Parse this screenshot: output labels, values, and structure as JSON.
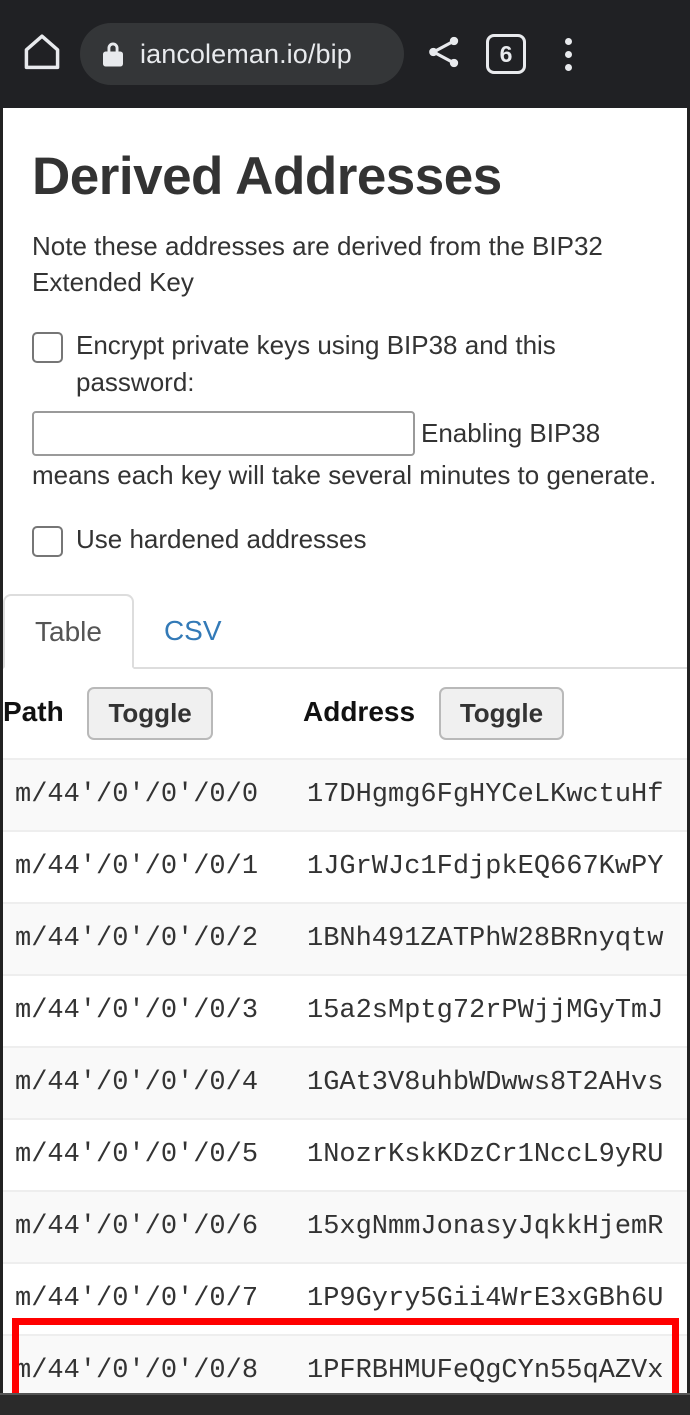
{
  "browser": {
    "home_icon": "home-icon",
    "lock_icon": "lock-icon",
    "url": "iancoleman.io/bip",
    "share_icon": "share-icon",
    "tab_count": "6",
    "menu_icon": "overflow-menu-icon"
  },
  "content": {
    "title": "Derived Addresses",
    "note": "Note these addresses are derived from the BIP32 Extended Key",
    "bip38": {
      "checkbox_label": "Encrypt private keys using BIP38 and this password:",
      "password_value": "",
      "password_placeholder": "",
      "after_input_text": "Enabling BIP38",
      "tail_text": "means each key will take several minutes to generate."
    },
    "hardened": {
      "checkbox_label": "Use hardened addresses"
    },
    "tabs": [
      {
        "label": "Table",
        "active": true
      },
      {
        "label": "CSV",
        "active": false
      }
    ],
    "table": {
      "headers": {
        "path": "Path",
        "path_toggle": "Toggle",
        "address": "Address",
        "address_toggle": "Toggle"
      },
      "rows": [
        {
          "path": "m/44'/0'/0'/0/0",
          "address": "17DHgmg6FgHYCeLKwctuHf"
        },
        {
          "path": "m/44'/0'/0'/0/1",
          "address": "1JGrWJc1FdjpkEQ667KwPY"
        },
        {
          "path": "m/44'/0'/0'/0/2",
          "address": "1BNh491ZATPhW28BRnyqtw"
        },
        {
          "path": "m/44'/0'/0'/0/3",
          "address": "15a2sMptg72rPWjjMGyTmJ"
        },
        {
          "path": "m/44'/0'/0'/0/4",
          "address": "1GAt3V8uhbWDwws8T2AHvs"
        },
        {
          "path": "m/44'/0'/0'/0/5",
          "address": "1NozrKskKDzCr1NccL9yRU"
        },
        {
          "path": "m/44'/0'/0'/0/6",
          "address": "15xgNmmJonasyJqkkHjemR"
        },
        {
          "path": "m/44'/0'/0'/0/7",
          "address": "1P9Gyry5Gii4WrE3xGBh6U"
        },
        {
          "path": "m/44'/0'/0'/0/8",
          "address": "1PFRBHMUFeQgCYn55qAZVx"
        }
      ]
    }
  },
  "annotation": {
    "highlight_color": "#ff0000"
  }
}
